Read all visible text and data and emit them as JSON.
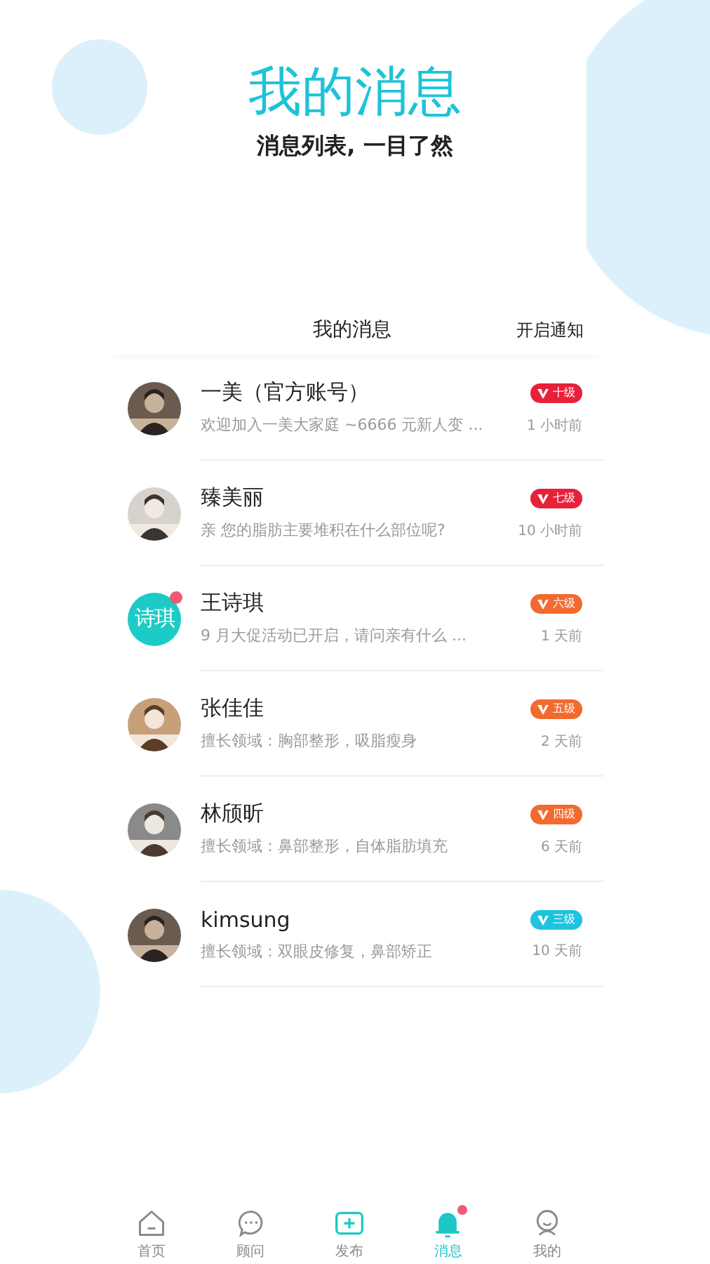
{
  "header": {
    "title": "我的消息",
    "subtitle": "消息列表, 一目了然"
  },
  "list_header": {
    "title": "我的消息",
    "action": "开启通知"
  },
  "messages": [
    {
      "name": "一美（官方账号）",
      "unread": false,
      "level": "十级",
      "color": "#e8213a",
      "preview": "欢迎加入一美大家庭 ~6666 元新人变 ...",
      "time": "1 小时前"
    },
    {
      "name": "臻美丽",
      "unread": false,
      "level": "七级",
      "color": "#e8213a",
      "preview": "亲 您的脂肪主要堆积在什么部位呢?",
      "time": "10 小时前"
    },
    {
      "name": "王诗琪",
      "avatar": {
        "kind": "text",
        "text": "诗琪"
      },
      "unread": true,
      "level": "六级",
      "color": "#f26a2e",
      "preview": "9 月大促活动已开启，请问亲有什么 ...",
      "time": "1 天前"
    },
    {
      "name": "张佳佳",
      "unread": false,
      "level": "五级",
      "color": "#f26a2e",
      "preview": "擅长领域：胸部整形，吸脂瘦身",
      "time": "2 天前"
    },
    {
      "name": "林颀昕",
      "unread": false,
      "level": "四级",
      "color": "#f26a2e",
      "preview": "擅长领域：鼻部整形，自体脂肪填充",
      "time": "6 天前"
    },
    {
      "name": "kimsung",
      "unread": false,
      "level": "三级",
      "color": "#1ec3e0",
      "preview": "擅长领域：双眼皮修复，鼻部矫正",
      "time": "10 天前"
    }
  ],
  "tab_bar": [
    {
      "label": "首页",
      "selected": false,
      "dot": false
    },
    {
      "label": "顾问",
      "selected": false,
      "dot": false
    },
    {
      "label": "发布",
      "selected": false,
      "dot": false
    },
    {
      "label": "消息",
      "selected": true,
      "dot": true
    },
    {
      "label": "我的",
      "selected": false,
      "dot": false
    }
  ]
}
